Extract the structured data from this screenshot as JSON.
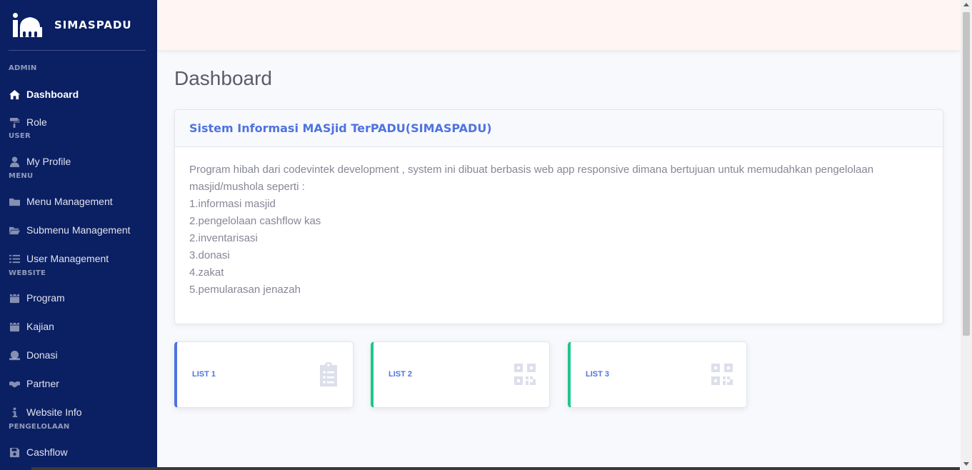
{
  "brand": {
    "name": "SIMASPADU",
    "logo_icon": "mosque-icon"
  },
  "sidebar": {
    "sections": {
      "admin": "ADMIN",
      "user": "USER",
      "menu": "MENU",
      "website": "WEBSITE",
      "pengelolaan": "PENGELOLAAN"
    },
    "items": [
      {
        "label": "Dashboard",
        "icon": "home-icon",
        "active": true
      },
      {
        "label": "Role",
        "icon": "paint-roller-icon"
      },
      {
        "label": "My Profile",
        "icon": "user-icon"
      },
      {
        "label": "Menu Management",
        "icon": "folder-icon"
      },
      {
        "label": "Submenu Management",
        "icon": "folder-open-icon"
      },
      {
        "label": "User Management",
        "icon": "list-icon"
      },
      {
        "label": "Program",
        "icon": "calendar-icon"
      },
      {
        "label": "Kajian",
        "icon": "calendar-icon"
      },
      {
        "label": "Donasi",
        "icon": "donate-icon"
      },
      {
        "label": "Partner",
        "icon": "handshake-icon"
      },
      {
        "label": "Website Info",
        "icon": "info-icon"
      },
      {
        "label": "Cashflow",
        "icon": "save-icon"
      }
    ]
  },
  "main": {
    "title": "Dashboard",
    "card": {
      "title": "Sistem Informasi MASjid TerPADU(SIMASPADU)",
      "lines": [
        "Program hibah dari codevintek development , system ini dibuat berbasis web app responsive dimana bertujuan untuk memudahkan pengelolaan",
        "masjid/mushola seperti :",
        "1.informasi masjid",
        "2.pengelolaan cashflow kas",
        "2.inventarisasi",
        "3.donasi",
        "4.zakat",
        "5.pemularasan jenazah"
      ]
    },
    "stats": [
      {
        "label": "LIST 1",
        "icon": "clipboard-list-icon",
        "border_color": "#4e73df"
      },
      {
        "label": "LIST 2",
        "icon": "qrcode-icon",
        "border_color": "#1cc88a"
      },
      {
        "label": "LIST 3",
        "icon": "qrcode-icon",
        "border_color": "#1cc88a"
      }
    ]
  },
  "colors": {
    "sidebar_bg": "#0b1f63",
    "primary": "#4e73df",
    "success": "#1cc88a",
    "topbar_bg": "#fff5f2"
  }
}
